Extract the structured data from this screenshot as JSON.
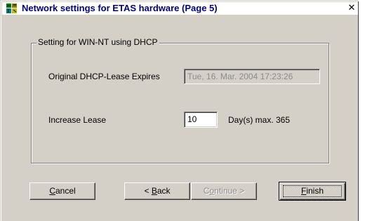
{
  "window": {
    "title": "Network settings for ETAS hardware (Page 5)",
    "icon": "network-app-icon",
    "close_glyph": "✕"
  },
  "group": {
    "label": "Setting for WIN-NT using DHCP",
    "original_lease_label": "Original DHCP-Lease Expires",
    "original_lease_value": "Tue, 16. Mar. 2004 17:23:26",
    "increase_label": "Increase Lease",
    "increase_value": "10",
    "increase_unit": "Day(s) max. 365"
  },
  "buttons": {
    "cancel": {
      "mnemonic": "C",
      "rest": "ancel"
    },
    "back": {
      "prefix": "< ",
      "mnemonic": "B",
      "rest": "ack"
    },
    "continue": {
      "label_a": "C",
      "mnemonic": "o",
      "rest": "ntinue >"
    },
    "finish": {
      "mnemonic": "F",
      "rest": "inish"
    }
  },
  "colors": {
    "title_text": "#000080",
    "face": "#d4d0c8",
    "disabled_text": "#8c8c8c"
  }
}
